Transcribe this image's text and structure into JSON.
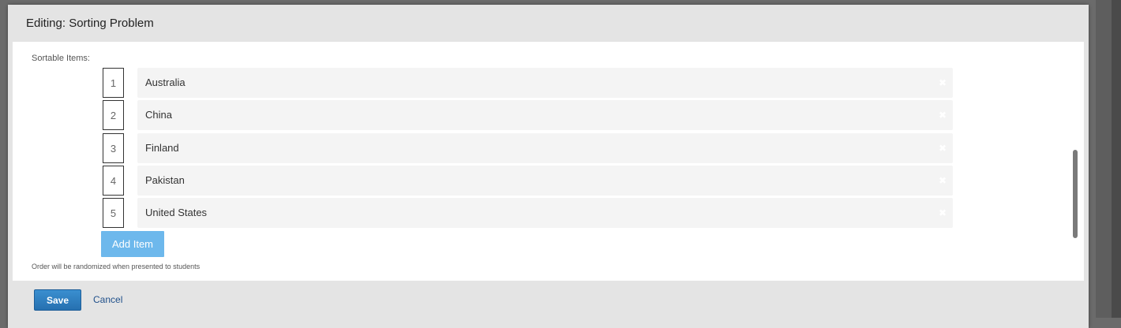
{
  "modal": {
    "title": "Editing: Sorting Problem"
  },
  "sortable": {
    "label": "Sortable Items:",
    "items": [
      {
        "order": "1",
        "text": "Australia"
      },
      {
        "order": "2",
        "text": "China"
      },
      {
        "order": "3",
        "text": "Finland"
      },
      {
        "order": "4",
        "text": "Pakistan"
      },
      {
        "order": "5",
        "text": "United States"
      }
    ],
    "add_item_label": "Add Item",
    "hint": "Order will be randomized when presented to students",
    "remove_icon": "close-icon"
  },
  "footer": {
    "save_label": "Save",
    "cancel_label": "Cancel"
  },
  "colors": {
    "add_button": "#6db8ec",
    "save_button": "#2a7bbf",
    "cancel_link": "#1f4f8a"
  }
}
